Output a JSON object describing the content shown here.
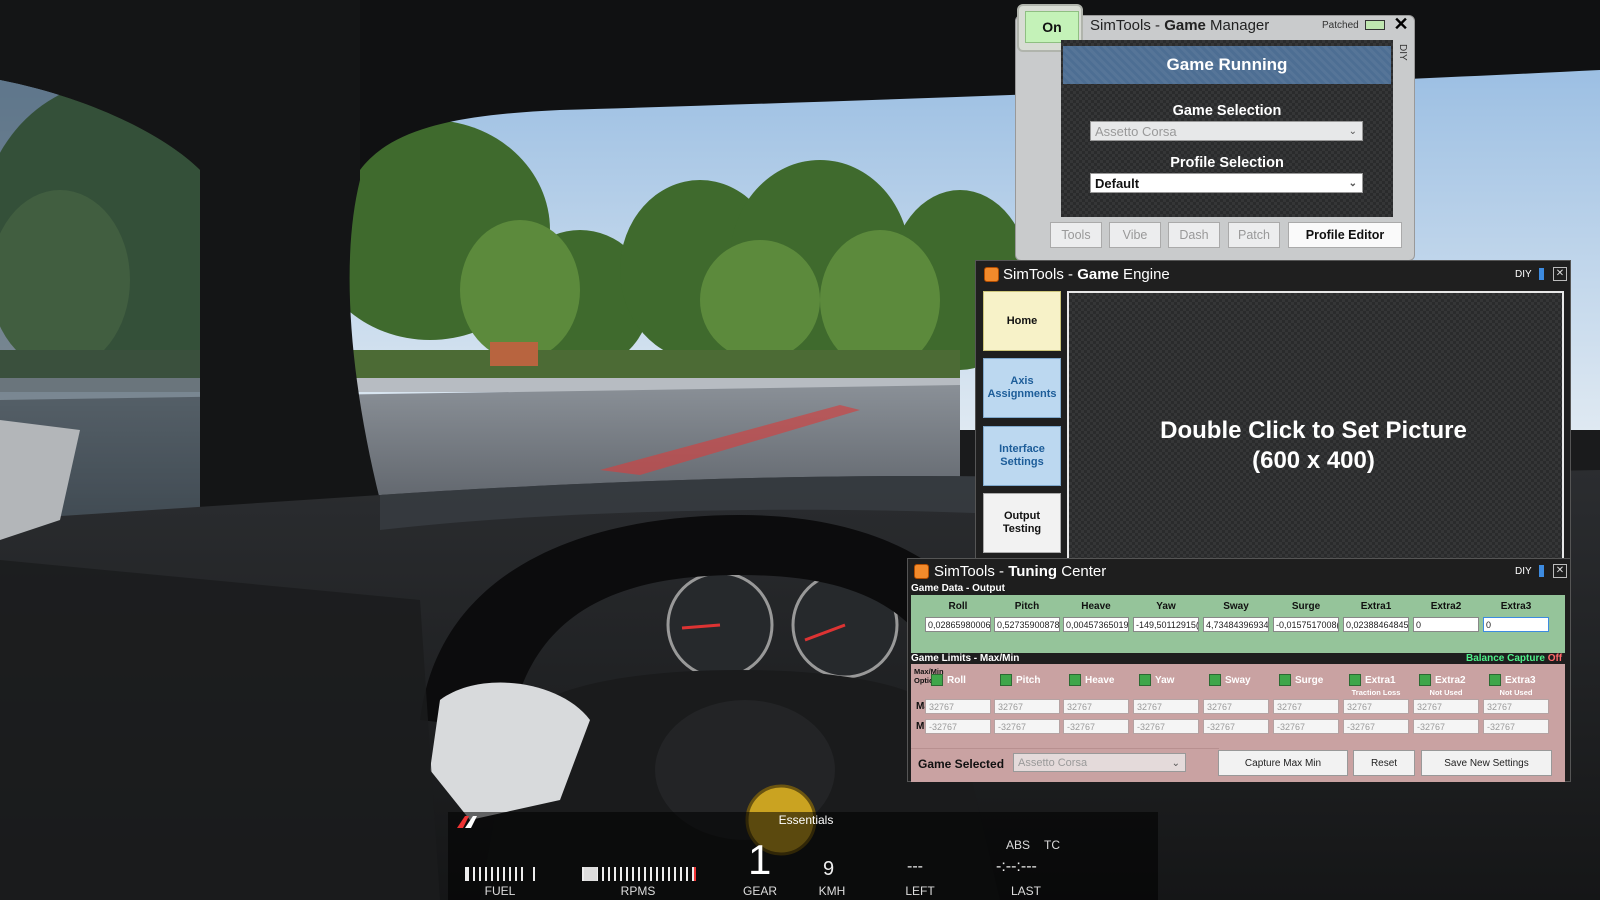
{
  "game_manager": {
    "on_label": "On",
    "title_prefix": "SimTools - ",
    "title_bold": "Game",
    "title_suffix": " Manager",
    "patched_label": "Patched",
    "close_label": "✕",
    "diy_label": "DIY",
    "status": "Game Running",
    "game_selection_label": "Game Selection",
    "game_selection_value": "Assetto Corsa",
    "profile_selection_label": "Profile Selection",
    "profile_selection_value": "Default",
    "tabs": [
      "Tools",
      "Vibe",
      "Dash",
      "Patch"
    ],
    "profile_editor_label": "Profile Editor"
  },
  "game_engine": {
    "title_prefix": "SimTools - ",
    "title_bold": "Game",
    "title_suffix": " Engine",
    "diy_label": "DIY",
    "side_buttons": [
      "Home",
      "Axis Assignments",
      "Interface Settings",
      "Output Testing"
    ],
    "picture_line1": "Double Click to Set Picture",
    "picture_line2": "(600 x 400)"
  },
  "tuning_center": {
    "title_prefix": "SimTools - ",
    "title_bold": "Tuning",
    "title_suffix": " Center",
    "diy_label": "DIY",
    "game_data_label": "Game Data - Output",
    "columns": [
      "Roll",
      "Pitch",
      "Heave",
      "Yaw",
      "Sway",
      "Surge",
      "Extra1",
      "Extra2",
      "Extra3"
    ],
    "outputs": [
      "0,02865980006",
      "0,52735900878",
      "0,00457365019",
      "-149,50112915(",
      "4,73484396934",
      "-0,0157517008(",
      "0,02388464845",
      "0",
      "0"
    ],
    "game_limits_label": "Game Limits - Max/Min",
    "balance_capture_label": "Balance Capture",
    "balance_capture_state": "Off",
    "maxmin_option_label": "Max/Min Option -",
    "notes": [
      "",
      "",
      "",
      "",
      "",
      "",
      "Traction Loss",
      "Not Used",
      "Not Used"
    ],
    "max_label": "Max",
    "min_label": "Min",
    "max_values": [
      "32767",
      "32767",
      "32767",
      "32767",
      "32767",
      "32767",
      "32767",
      "32767",
      "32767"
    ],
    "min_values": [
      "-32767",
      "-32767",
      "-32767",
      "-32767",
      "-32767",
      "-32767",
      "-32767",
      "-32767",
      "-32767"
    ],
    "game_selected_label": "Game Selected",
    "game_selected_value": "Assetto Corsa",
    "capture_button": "Capture Max Min",
    "reset_button": "Reset",
    "save_button": "Save New Settings"
  },
  "hud": {
    "essentials_label": "Essentials",
    "fuel_label": "FUEL",
    "rpms_label": "RPMS",
    "gear_value": "1",
    "gear_label": "GEAR",
    "speed_value": "9",
    "speed_label": "KMH",
    "left_value": "---",
    "left_label": "LEFT",
    "last_value": "-:--:---",
    "last_label": "LAST",
    "abs_label": "ABS",
    "tc_label": "TC",
    "fuel_level": 0.85,
    "rpm_level": 0.12
  }
}
